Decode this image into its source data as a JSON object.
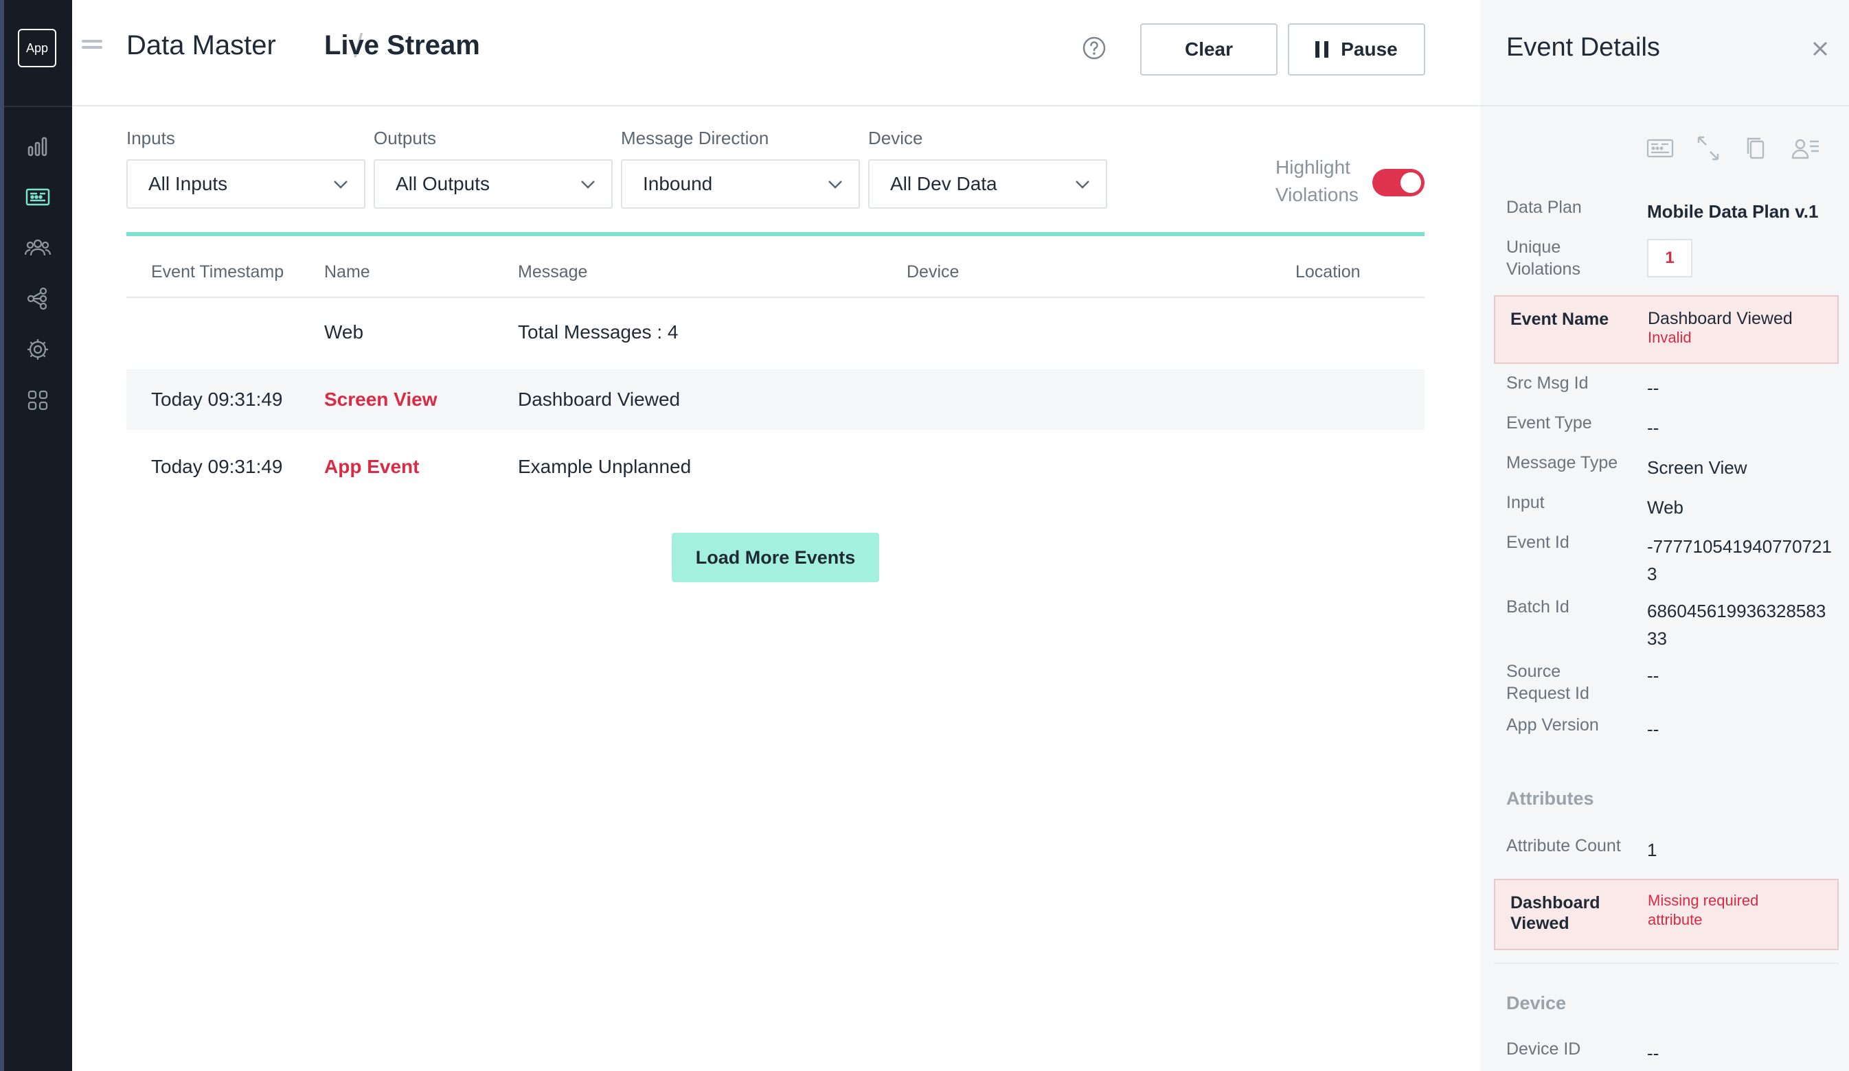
{
  "sidebar": {
    "logo_text": "App",
    "items": [
      {
        "icon": "bar-chart-icon",
        "active": false
      },
      {
        "icon": "live-stream-icon",
        "active": true
      },
      {
        "icon": "users-icon",
        "active": false
      },
      {
        "icon": "connections-icon",
        "active": false
      },
      {
        "icon": "gear-icon",
        "active": false
      },
      {
        "icon": "grid-icon",
        "active": false
      }
    ]
  },
  "header": {
    "breadcrumb_parent": "Data Master",
    "breadcrumb_separator": "/",
    "breadcrumb_current": "Live Stream",
    "clear_label": "Clear",
    "pause_label": "Pause"
  },
  "filters": {
    "inputs": {
      "label": "Inputs",
      "value": "All Inputs"
    },
    "outputs": {
      "label": "Outputs",
      "value": "All Outputs"
    },
    "direction": {
      "label": "Message Direction",
      "value": "Inbound"
    },
    "device": {
      "label": "Device",
      "value": "All Dev Data"
    },
    "highlight_label_1": "Highlight",
    "highlight_label_2": "Violations",
    "highlight_on": true
  },
  "table": {
    "columns": [
      "Event Timestamp",
      "Name",
      "Message",
      "Device",
      "Location"
    ],
    "summary_row": {
      "name": "Web",
      "message": "Total Messages : 4"
    },
    "rows": [
      {
        "timestamp": "Today 09:31:49",
        "name": "Screen View",
        "message": "Dashboard Viewed"
      },
      {
        "timestamp": "Today 09:31:49",
        "name": "App Event",
        "message": "Example Unplanned"
      }
    ],
    "load_more_label": "Load More Events"
  },
  "details": {
    "title": "Event Details",
    "data_plan_key": "Data Plan",
    "data_plan_value": "Mobile Data Plan v.1",
    "unique_violations_key_1": "Unique",
    "unique_violations_key_2": "Violations",
    "unique_violations_value": "1",
    "event_name_key": "Event Name",
    "event_name_value": "Dashboard Viewed",
    "event_name_status": "Invalid",
    "src_msg_id_key": "Src Msg Id",
    "src_msg_id_value": "--",
    "event_type_key": "Event Type",
    "event_type_value": "--",
    "message_type_key": "Message Type",
    "message_type_value": "Screen View",
    "input_key": "Input",
    "input_value": "Web",
    "event_id_key": "Event Id",
    "event_id_line1": "-777710541940770721",
    "event_id_line2": "3",
    "batch_id_key": "Batch Id",
    "batch_id_line1": "686045619936328583",
    "batch_id_line2": "33",
    "source_request_key_1": "Source",
    "source_request_key_2": "Request Id",
    "source_request_value": "--",
    "app_version_key": "App Version",
    "app_version_value": "--",
    "attributes_title": "Attributes",
    "attribute_count_key": "Attribute Count",
    "attribute_count_value": "1",
    "attr_error_key_1": "Dashboard",
    "attr_error_key_2": "Viewed",
    "attr_error_msg_1": "Missing required",
    "attr_error_msg_2": "attribute",
    "device_title": "Device",
    "device_id_key": "Device ID",
    "device_id_value": "--"
  },
  "colors": {
    "sidebar_bg": "#171c24",
    "accent_teal": "#7ee0cf",
    "button_teal": "#a3f0de",
    "violation_red": "#db2a43",
    "error_card_bg": "#f9e9e9"
  }
}
